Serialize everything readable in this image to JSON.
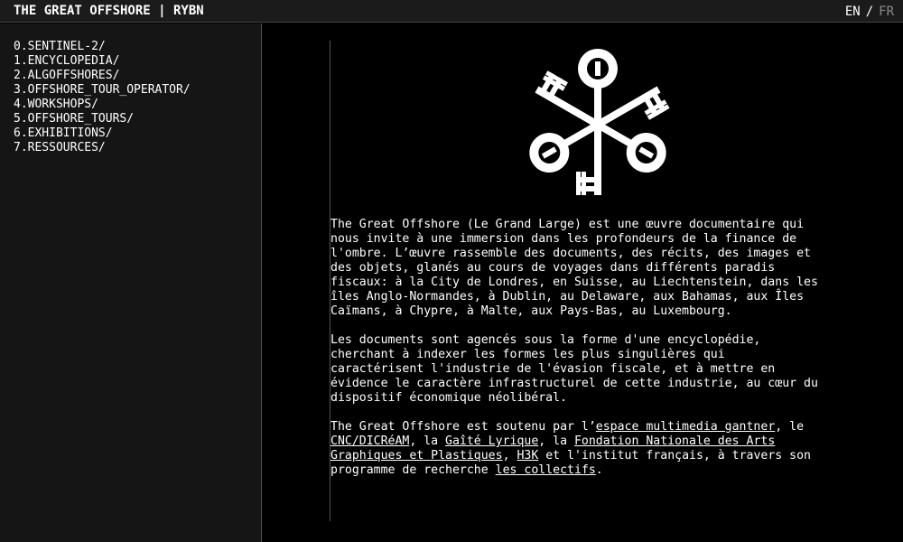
{
  "header": {
    "title": "THE GREAT OFFSHORE | RYBN",
    "lang_en": "EN",
    "lang_sep": "/",
    "lang_fr": "FR"
  },
  "menu": [
    "0.SENTINEL-2/",
    "1.ENCYCLOPEDIA/",
    "2.ALGOFFSHORES/",
    "3.OFFSHORE_TOUR_OPERATOR/",
    "4.WORKSHOPS/",
    "5.OFFSHORE_TOURS/",
    "6.EXHIBITIONS/",
    "7.RESSOURCES/"
  ],
  "logo": {
    "icon": "crossed-keys-logo-icon"
  },
  "content": {
    "p1": "The Great Offshore (Le Grand Large) est une œuvre documentaire qui nous invite à une immersion dans les profondeurs de la finance de l'ombre. L’œuvre rassemble des documents, des récits, des images et des objets, glanés au cours de voyages dans différents paradis fiscaux: à la City de Londres, en Suisse, au Liechtenstein, dans les îles Anglo-Normandes, à Dublin, au Delaware, aux Bahamas, aux Îles Caïmans, à Chypre, à Malte, aux Pays-Bas, au Luxembourg.",
    "p2": "Les documents sont agencés sous la forme d'une encyclopédie, cherchant à indexer les formes les plus singulières qui caractérisent l'industrie de l'évasion fiscale, et à mettre en évidence le caractère infrastructurel de cette industrie, au cœur du dispositif économique néolibéral.",
    "p3": {
      "t1": "The Great Offshore est soutenu par l’",
      "l1": "espace multimedia gantner",
      "t2": ", le ",
      "l2": "CNC/DICRéAM",
      "t3": ", la ",
      "l3": "Gaîté Lyrique",
      "t4": ", la ",
      "l4": "Fondation Nationale des Arts Graphiques et Plastiques",
      "t5": ", ",
      "l5": "H3K",
      "t6": " et l'institut français, à travers son programme de recherche ",
      "l6": "les collectifs",
      "t7": "."
    }
  }
}
